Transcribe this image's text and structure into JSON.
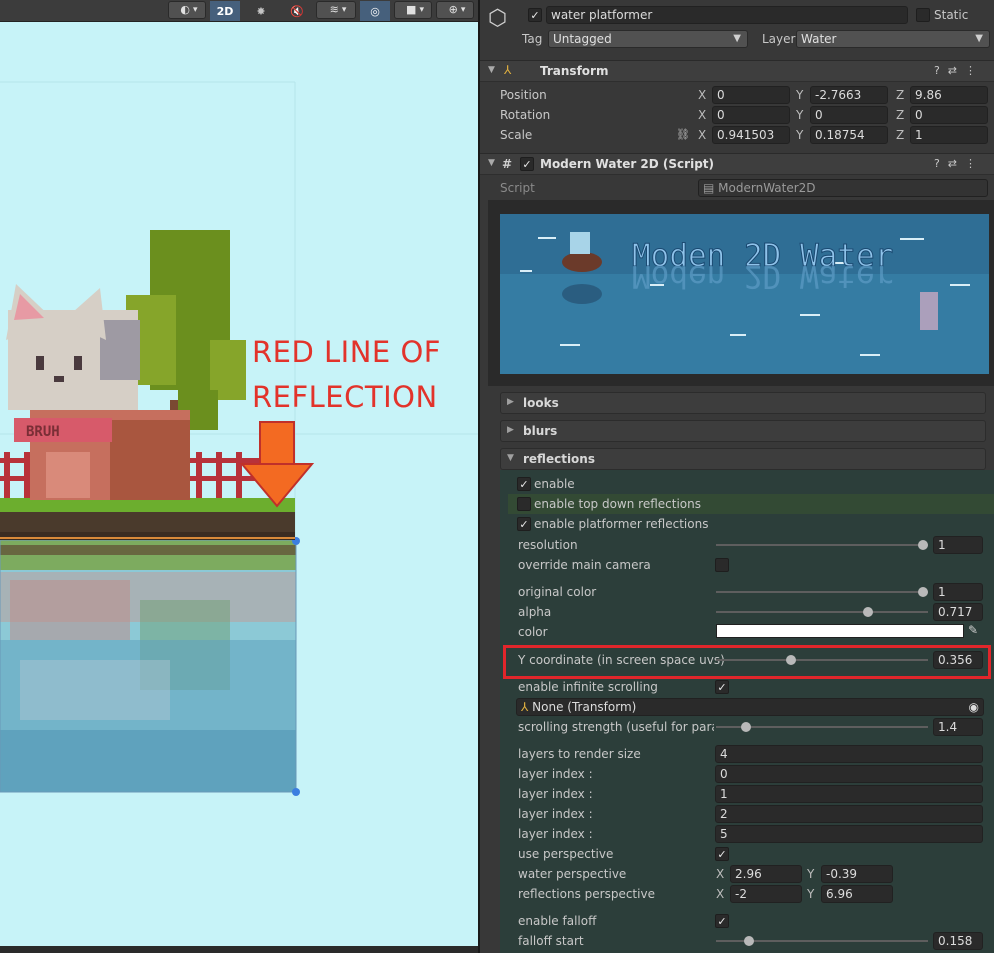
{
  "toolbar": {
    "buttons": [
      {
        "name": "shading-mode-dropdown",
        "label": "◐",
        "active": false
      },
      {
        "name": "2d-toggle-button",
        "label": "2D",
        "active": true
      },
      {
        "name": "lighting-toggle-button",
        "label": "✸",
        "active": false
      },
      {
        "name": "audio-toggle-button",
        "label": "🔇",
        "active": false
      },
      {
        "name": "effects-dropdown",
        "label": "≋",
        "active": false
      },
      {
        "name": "hidden-objects-toggle-button",
        "label": "◎",
        "active": true
      },
      {
        "name": "camera-dropdown",
        "label": "■",
        "active": false
      },
      {
        "name": "gizmos-dropdown",
        "label": "⊕",
        "active": false
      }
    ]
  },
  "scene": {
    "annotation_line1": "RED LINE OF",
    "annotation_line2": "REFLECTION",
    "sign_text": "BRUH",
    "colors": {
      "sky": "#c7f3f8",
      "water": "#6fb4c8",
      "grass": "#6cae2e",
      "arrow": "#f36a22",
      "annotation": "#e2332b"
    }
  },
  "object": {
    "enabled": true,
    "name": "water platformer",
    "static_label": "Static",
    "static_checked": false,
    "tag_label": "Tag",
    "tag_value": "Untagged",
    "layer_label": "Layer",
    "layer_value": "Water"
  },
  "transform": {
    "title": "Transform",
    "position_label": "Position",
    "rotation_label": "Rotation",
    "scale_label": "Scale",
    "position": {
      "x": "0",
      "y": "-2.7663",
      "z": "9.86"
    },
    "rotation": {
      "x": "0",
      "y": "0",
      "z": "0"
    },
    "scale": {
      "x": "0.941503",
      "y": "0.18754",
      "z": "1"
    }
  },
  "axis": {
    "x": "X",
    "y": "Y",
    "z": "Z"
  },
  "script_component": {
    "title": "Modern Water 2D (Script)",
    "script_label": "Script",
    "script_value": "ModernWater2D",
    "banner_text": "Moden 2D Water",
    "sections": {
      "looks": "looks",
      "blurs": "blurs",
      "reflections": "reflections"
    }
  },
  "reflections": {
    "enable": {
      "label": "enable",
      "checked": true
    },
    "top_down": {
      "label": "enable top down reflections",
      "checked": false
    },
    "platformer": {
      "label": "enable platformer reflections",
      "checked": true
    },
    "resolution": {
      "label": "resolution",
      "value": "1",
      "level": 1.0
    },
    "override_camera": {
      "label": "override main camera",
      "checked": false
    },
    "original_color": {
      "label": "original color",
      "value": "1",
      "level": 1.0
    },
    "alpha": {
      "label": "alpha",
      "value": "0.717",
      "level": 0.717
    },
    "color": {
      "label": "color",
      "hex": "#ffffff"
    },
    "y_coordinate": {
      "label": "Y coordinate (in screen space uvs)",
      "value": "0.356",
      "level": 0.356
    },
    "infinite_scrolling": {
      "label": "enable infinite scrolling",
      "checked": true
    },
    "transform_ref": "None (Transform)",
    "scrolling_strength": {
      "label": "scrolling strength (useful for paralla",
      "value": "1.4",
      "level": 0.14
    },
    "layers_size": {
      "label": "layers to render size",
      "value": "4"
    },
    "layer_index_label": "layer index :",
    "layer_indices": [
      "0",
      "1",
      "2",
      "5"
    ],
    "use_perspective": {
      "label": "use perspective",
      "checked": true
    },
    "water_perspective": {
      "label": "water perspective",
      "x": "2.96",
      "y": "-0.39"
    },
    "reflections_perspective": {
      "label": "reflections perspective",
      "x": "-2",
      "y": "6.96"
    },
    "falloff": {
      "label": "enable falloff",
      "checked": true
    },
    "falloff_start": {
      "label": "falloff start",
      "value": "0.158",
      "level": 0.158
    }
  }
}
